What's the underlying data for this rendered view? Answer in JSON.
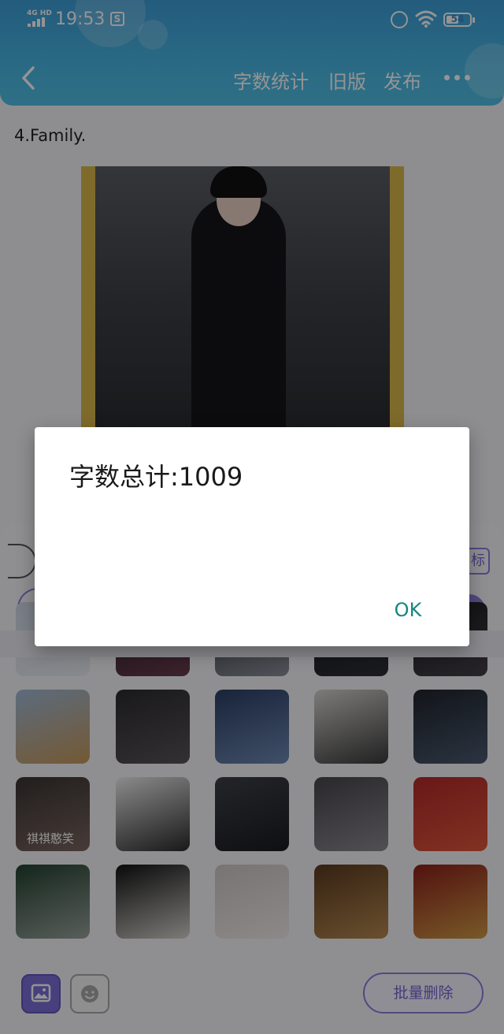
{
  "status_bar": {
    "network": "4G HD",
    "time": "19:53",
    "battery": "54",
    "battery_level": 0.54,
    "icons": [
      "signal-icon",
      "screenshot-s-icon",
      "alarm-icon",
      "wifi-icon",
      "battery-icon"
    ]
  },
  "header": {
    "nav_word_count": "字数统计",
    "nav_old_version": "旧版",
    "nav_publish": "发布",
    "icons": [
      "back-arrow-icon",
      "more-dots-icon"
    ]
  },
  "editor": {
    "paragraph": "4.Family."
  },
  "toolbar": {
    "partial_right_label": "标"
  },
  "gallery": {
    "thumbs": [
      {
        "caption": "",
        "colors": [
          "#cfd9e6",
          "#e9edf2"
        ]
      },
      {
        "caption": "",
        "colors": [
          "#2a2530",
          "#6a3a4a"
        ]
      },
      {
        "caption": "",
        "colors": [
          "#3a3d44",
          "#8a8e98"
        ]
      },
      {
        "caption": "",
        "colors": [
          "#1b1c22",
          "#2e2f36"
        ]
      },
      {
        "caption": "",
        "colors": [
          "#1a1a1c",
          "#454048"
        ]
      },
      {
        "caption": "",
        "colors": [
          "#9fb9d8",
          "#c89a5a"
        ]
      },
      {
        "caption": "",
        "colors": [
          "#2b2a2e",
          "#5a5458"
        ]
      },
      {
        "caption": "",
        "colors": [
          "#2a3e63",
          "#6f89b5"
        ]
      },
      {
        "caption": "",
        "colors": [
          "#d8d4d2",
          "#3a3a3a"
        ]
      },
      {
        "caption": "",
        "colors": [
          "#20242c",
          "#4a5a70"
        ]
      },
      {
        "caption": "祺祺憨笑",
        "colors": [
          "#3a3432",
          "#7a6660"
        ]
      },
      {
        "caption": "",
        "colors": [
          "#efefef",
          "#2b2b2b"
        ]
      },
      {
        "caption": "",
        "colors": [
          "#3e4047",
          "#1a1b1f"
        ]
      },
      {
        "caption": "",
        "colors": [
          "#47454a",
          "#8e8990"
        ]
      },
      {
        "caption": "",
        "colors": [
          "#b5292a",
          "#e0573a"
        ]
      },
      {
        "caption": "",
        "colors": [
          "#23412e",
          "#9aa39e"
        ]
      },
      {
        "caption": "",
        "colors": [
          "#101112",
          "#d8d4cf"
        ]
      },
      {
        "caption": "",
        "colors": [
          "#cfc8c6",
          "#f2eceb"
        ]
      },
      {
        "caption": "",
        "colors": [
          "#5a3a1e",
          "#b88a52"
        ]
      },
      {
        "caption": "",
        "colors": [
          "#8c1f1a",
          "#d09a46"
        ]
      }
    ]
  },
  "bottom_bar": {
    "batch_delete_label": "批量删除",
    "icons": [
      "image-icon",
      "emoji-icon"
    ]
  },
  "dialog": {
    "message": "字数总计:1009",
    "ok_label": "OK"
  }
}
